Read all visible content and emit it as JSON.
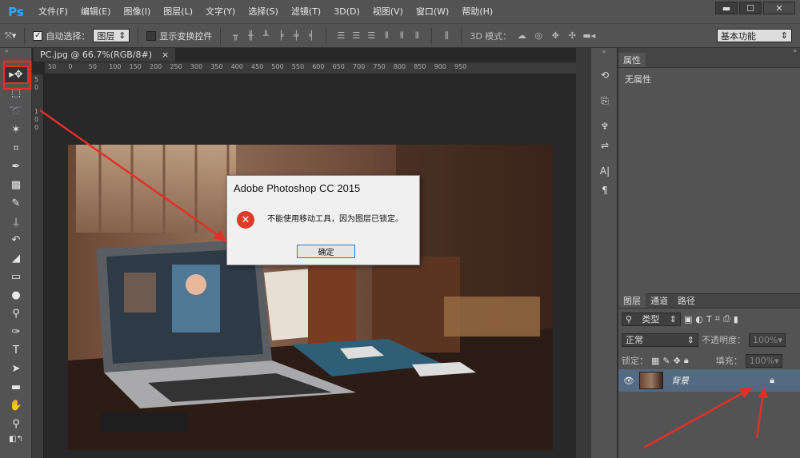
{
  "app": {
    "logo": "Ps"
  },
  "menu": [
    "文件(F)",
    "编辑(E)",
    "图像(I)",
    "图层(L)",
    "文字(Y)",
    "选择(S)",
    "滤镜(T)",
    "3D(D)",
    "视图(V)",
    "窗口(W)",
    "帮助(H)"
  ],
  "window_controls": {
    "minimize": "▬",
    "maximize": "☐",
    "close": "✕"
  },
  "options": {
    "auto_select_label": "自动选择：",
    "auto_select_value": "图层",
    "show_transform_label": "显示变换控件",
    "mode3d_label": "3D 模式：",
    "workspace": "基本功能"
  },
  "document": {
    "tab_title": "PC.jpg @ 66.7%(RGB/8#)",
    "tab_close": "×",
    "ruler_ticks": [
      "50",
      "0",
      "50",
      "100",
      "150",
      "200",
      "250",
      "300",
      "350",
      "400",
      "450",
      "500",
      "550",
      "600",
      "650",
      "700",
      "750",
      "800",
      "850",
      "900",
      "950"
    ]
  },
  "dialog": {
    "title": "Adobe Photoshop CC 2015",
    "message": "不能使用移动工具，因为图层已锁定。",
    "ok": "确定"
  },
  "properties": {
    "tab": "属性",
    "empty": "无属性"
  },
  "layers": {
    "tabs": [
      "图层",
      "通道",
      "路径"
    ],
    "kind_filter": "类型",
    "blend_mode": "正常",
    "opacity_label": "不透明度：",
    "opacity_value": "100%",
    "lock_label": "锁定：",
    "fill_label": "填充：",
    "fill_value": "100%",
    "layer_name": "背景"
  },
  "colors": {
    "accent_red": "#e0302a",
    "layer_selected": "#546a82",
    "panel_bg": "#535353"
  }
}
